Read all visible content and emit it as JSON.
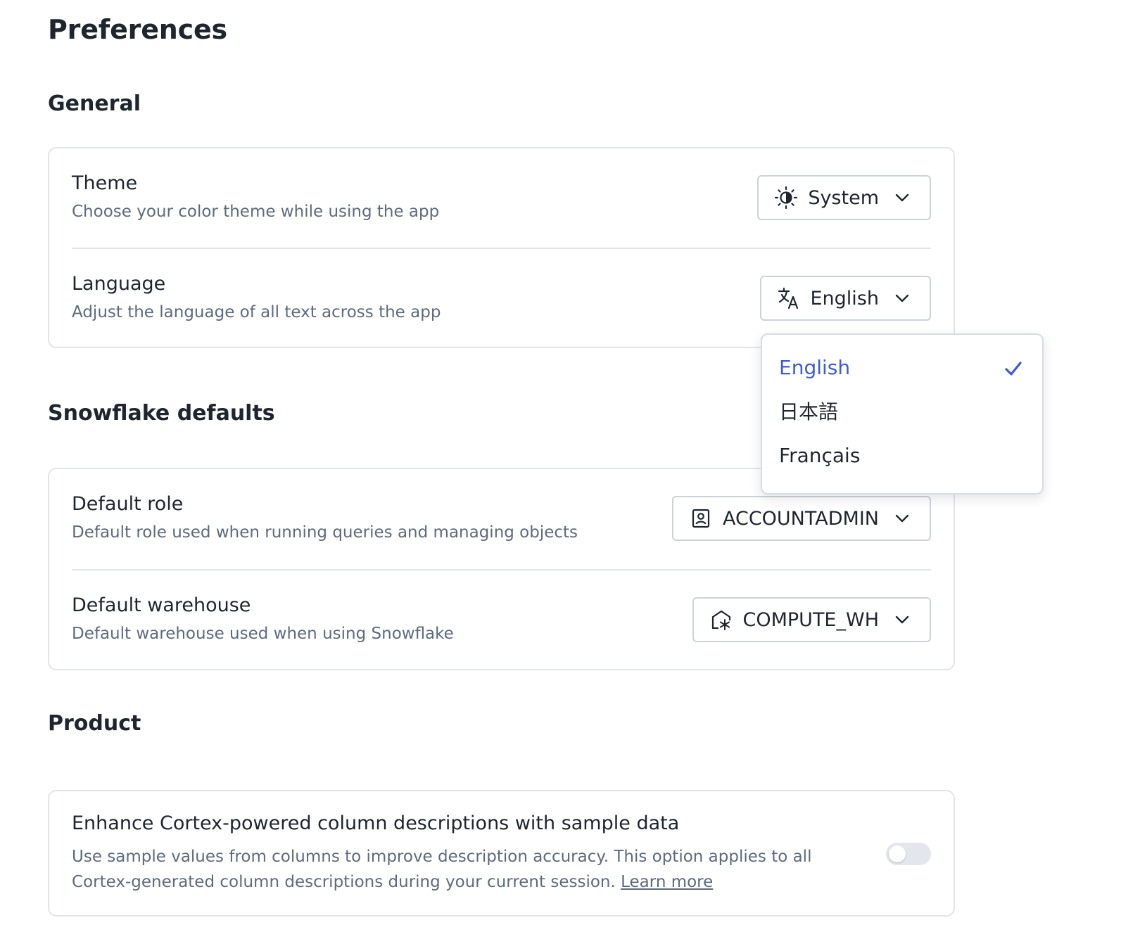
{
  "page": {
    "title": "Preferences"
  },
  "general": {
    "heading": "General",
    "theme": {
      "title": "Theme",
      "description": "Choose your color theme while using the app",
      "selected": "System",
      "icon": "sun-half-icon"
    },
    "language": {
      "title": "Language",
      "description": "Adjust the language of all text across the app",
      "selected": "English",
      "icon": "translate-icon"
    }
  },
  "language_dropdown": {
    "options": [
      {
        "label": "English",
        "selected": true
      },
      {
        "label": "日本語",
        "selected": false
      },
      {
        "label": "Français",
        "selected": false
      }
    ],
    "selected_color": "#3c5bd6"
  },
  "snowflake_defaults": {
    "heading": "Snowflake defaults",
    "role": {
      "title": "Default role",
      "description": "Default role used when running queries and managing objects",
      "selected": "ACCOUNTADMIN",
      "icon": "user-badge-icon"
    },
    "warehouse": {
      "title": "Default warehouse",
      "description": "Default warehouse used when using Snowflake",
      "selected": "COMPUTE_WH",
      "icon": "warehouse-snowflake-icon"
    }
  },
  "product": {
    "heading": "Product",
    "cortex": {
      "title": "Enhance Cortex-powered column descriptions with sample data",
      "description": "Use sample values from columns to improve description accuracy. This option applies to all Cortex-generated column descriptions during your current session.",
      "link_label": "Learn more",
      "enabled": false
    }
  },
  "colors": {
    "text_primary": "#1e252f",
    "text_secondary": "#5d6a7e",
    "border": "#e2e4e9",
    "accent": "#3c5bd6",
    "toggle_off": "#e3e6ec"
  }
}
